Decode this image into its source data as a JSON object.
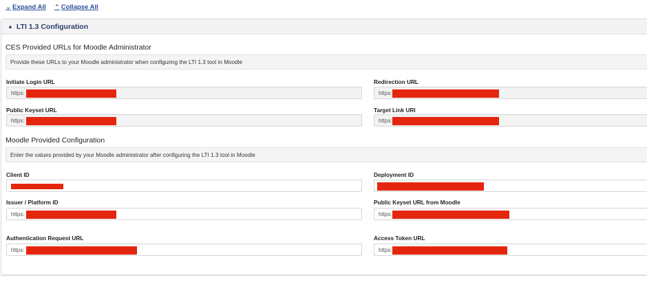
{
  "toolbar": {
    "expand_all": "Expand All",
    "collapse_all": "Collapse All",
    "expand_icon": "chevron-down-icon",
    "collapse_icon": "chevron-up-icon"
  },
  "panel": {
    "title": "LTI 1.3 Configuration",
    "caret_icon": "caret-up-icon"
  },
  "ces_section": {
    "title": "CES Provided URLs for Moodle Administrator",
    "hint": "Provide these URLs to your Moodle administrator when configuring the LTI 1.3 tool in Moodle",
    "fields": {
      "initiate_login_url": {
        "label": "Initiate Login URL",
        "value": "https:"
      },
      "redirection_url": {
        "label": "Redirection URL",
        "value": "https:"
      },
      "public_keyset_url": {
        "label": "Public Keyset URL",
        "value": "https:"
      },
      "target_link_uri": {
        "label": "Target Link URI",
        "value": "https:"
      }
    }
  },
  "moodle_section": {
    "title": "Moodle Provided Configuration",
    "hint": "Enter the values provided by your Moodle administrator after configuring the LTI 1.3 tool in Moodle",
    "fields": {
      "client_id": {
        "label": "Client ID",
        "value": ""
      },
      "deployment_id": {
        "label": "Deployment ID",
        "value": ""
      },
      "issuer_platform_id": {
        "label": "Issuer / Platform ID",
        "value": "https:"
      },
      "public_keyset_url_moodle": {
        "label": "Public Keyset URL from Moodle",
        "value": "https:"
      },
      "auth_request_url": {
        "label": "Authentication Request URL",
        "value": "https:"
      },
      "access_token_url": {
        "label": "Access Token URL",
        "value": "https:"
      }
    }
  },
  "colors": {
    "link": "#2b4e9b",
    "panel_title": "#2d3b6b",
    "redaction": "#e5260f"
  }
}
